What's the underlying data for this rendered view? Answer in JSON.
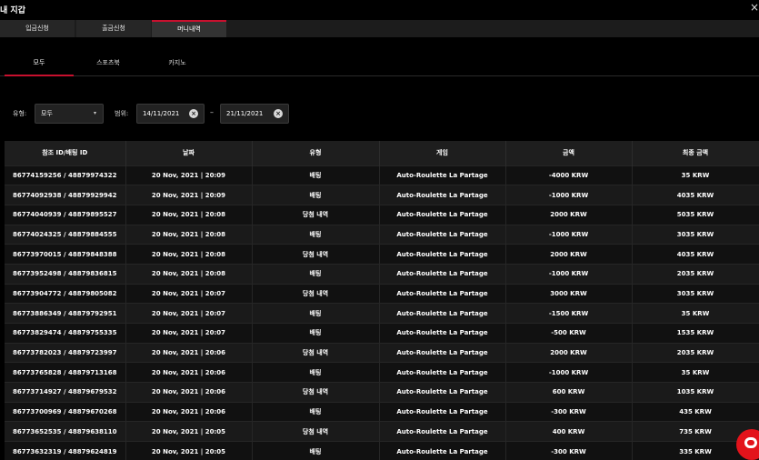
{
  "window": {
    "title": "내 지갑",
    "close": "×"
  },
  "tabs": [
    {
      "label": "입금신청"
    },
    {
      "label": "출금신청"
    },
    {
      "label": "머니내역",
      "active": true
    }
  ],
  "subtabs": [
    {
      "label": "모두",
      "active": true
    },
    {
      "label": "스포츠북"
    },
    {
      "label": "카지노"
    }
  ],
  "filters": {
    "type_label": "유형:",
    "type_value": "모두",
    "range_label": "범위:",
    "date_from": "14/11/2021",
    "date_to": "21/11/2021",
    "separator": "–",
    "clear_glyph": "×",
    "arrow_glyph": "▾"
  },
  "table": {
    "headers": [
      "참조 ID/배팅 ID",
      "날짜",
      "유형",
      "게임",
      "금액",
      "최종 금액"
    ],
    "rows": [
      [
        "86774159256 / 48879974322",
        "20 Nov, 2021 | 20:09",
        "배팅",
        "Auto-Roulette La Partage",
        "-4000 KRW",
        "35 KRW"
      ],
      [
        "86774092938 / 48879929942",
        "20 Nov, 2021 | 20:09",
        "배팅",
        "Auto-Roulette La Partage",
        "-1000 KRW",
        "4035 KRW"
      ],
      [
        "86774040939 / 48879895527",
        "20 Nov, 2021 | 20:08",
        "당첨 내역",
        "Auto-Roulette La Partage",
        "2000 KRW",
        "5035 KRW"
      ],
      [
        "86774024325 / 48879884555",
        "20 Nov, 2021 | 20:08",
        "배팅",
        "Auto-Roulette La Partage",
        "-1000 KRW",
        "3035 KRW"
      ],
      [
        "86773970015 / 48879848388",
        "20 Nov, 2021 | 20:08",
        "당첨 내역",
        "Auto-Roulette La Partage",
        "2000 KRW",
        "4035 KRW"
      ],
      [
        "86773952498 / 48879836815",
        "20 Nov, 2021 | 20:08",
        "배팅",
        "Auto-Roulette La Partage",
        "-1000 KRW",
        "2035 KRW"
      ],
      [
        "86773904772 / 48879805082",
        "20 Nov, 2021 | 20:07",
        "당첨 내역",
        "Auto-Roulette La Partage",
        "3000 KRW",
        "3035 KRW"
      ],
      [
        "86773886349 / 48879792951",
        "20 Nov, 2021 | 20:07",
        "배팅",
        "Auto-Roulette La Partage",
        "-1500 KRW",
        "35 KRW"
      ],
      [
        "86773829474 / 48879755335",
        "20 Nov, 2021 | 20:07",
        "배팅",
        "Auto-Roulette La Partage",
        "-500 KRW",
        "1535 KRW"
      ],
      [
        "86773782023 / 48879723997",
        "20 Nov, 2021 | 20:06",
        "당첨 내역",
        "Auto-Roulette La Partage",
        "2000 KRW",
        "2035 KRW"
      ],
      [
        "86773765828 / 48879713168",
        "20 Nov, 2021 | 20:06",
        "배팅",
        "Auto-Roulette La Partage",
        "-1000 KRW",
        "35 KRW"
      ],
      [
        "86773714927 / 48879679532",
        "20 Nov, 2021 | 20:06",
        "당첨 내역",
        "Auto-Roulette La Partage",
        "600 KRW",
        "1035 KRW"
      ],
      [
        "86773700969 / 48879670268",
        "20 Nov, 2021 | 20:06",
        "배팅",
        "Auto-Roulette La Partage",
        "-300 KRW",
        "435 KRW"
      ],
      [
        "86773652535 / 48879638110",
        "20 Nov, 2021 | 20:05",
        "당첨 내역",
        "Auto-Roulette La Partage",
        "400 KRW",
        "735 KRW"
      ],
      [
        "86773632319 / 48879624819",
        "20 Nov, 2021 | 20:05",
        "배팅",
        "Auto-Roulette La Partage",
        "-300 KRW",
        "335 KRW"
      ]
    ]
  },
  "colors": {
    "accent": "#c8102e",
    "chat": "#e3131b"
  },
  "icons": {
    "close": "close-icon",
    "clear": "clear-icon",
    "dropdown": "chevron-down-icon",
    "chat": "chat-icon"
  }
}
